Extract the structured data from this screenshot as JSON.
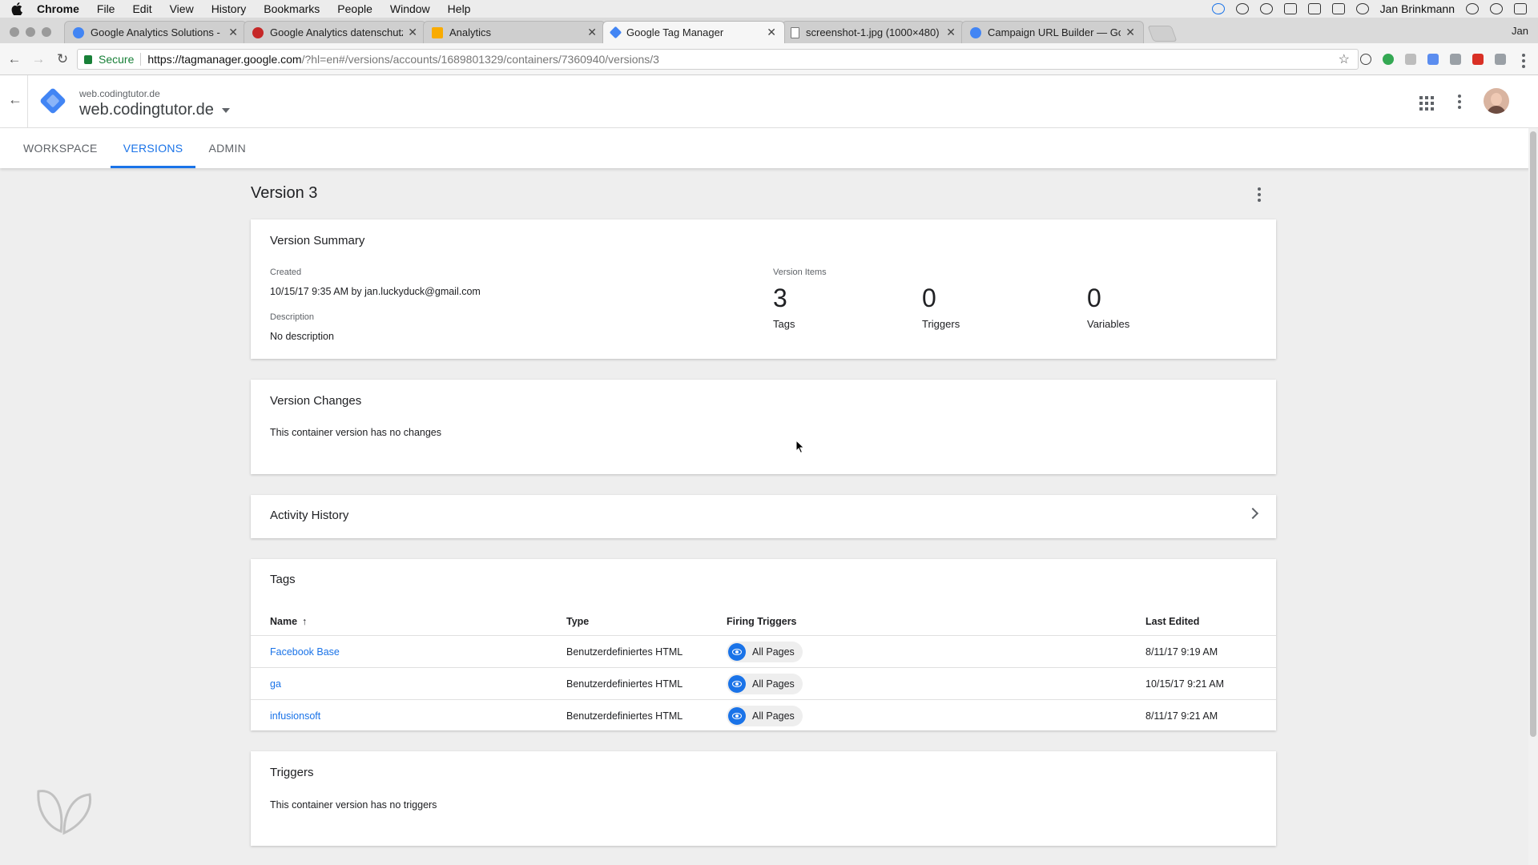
{
  "menubar": {
    "app": "Chrome",
    "items": [
      "File",
      "Edit",
      "View",
      "History",
      "Bookmarks",
      "People",
      "Window",
      "Help"
    ],
    "user": "Jan Brinkmann"
  },
  "browser": {
    "profile": "Jan",
    "tabs": [
      {
        "title": "Google Analytics Solutions - M",
        "favicon_color": "#4285f4",
        "active": false
      },
      {
        "title": "Google Analytics datenschutz",
        "favicon_color": "#c62828",
        "active": false
      },
      {
        "title": "Analytics",
        "favicon_color": "#f9ab00",
        "active": false
      },
      {
        "title": "Google Tag Manager",
        "favicon_color": "#4285f4",
        "active": true
      },
      {
        "title": "screenshot-1.jpg (1000×480)",
        "favicon_color": "#9e9e9e",
        "active": false
      },
      {
        "title": "Campaign URL Builder — Goo",
        "favicon_color": "#4285f4",
        "active": false
      }
    ],
    "secure_label": "Secure",
    "url_host": "https://tagmanager.google.com",
    "url_path": "/?hl=en#/versions/accounts/1689801329/containers/7360940/versions/3"
  },
  "header": {
    "account": "web.codingtutor.de",
    "container": "web.codingtutor.de"
  },
  "nav": {
    "tabs": [
      "WORKSPACE",
      "VERSIONS",
      "ADMIN"
    ],
    "active": "VERSIONS"
  },
  "page": {
    "title": "Version 3"
  },
  "summary": {
    "title": "Version Summary",
    "created_label": "Created",
    "created_value": "10/15/17 9:35 AM by jan.luckyduck@gmail.com",
    "description_label": "Description",
    "description_value": "No description",
    "items_label": "Version Items",
    "tags_count": "3",
    "tags_label": "Tags",
    "triggers_count": "0",
    "triggers_label": "Triggers",
    "variables_count": "0",
    "variables_label": "Variables"
  },
  "changes": {
    "title": "Version Changes",
    "message": "This container version has no changes"
  },
  "activity": {
    "title": "Activity History"
  },
  "tags": {
    "title": "Tags",
    "columns": {
      "name": "Name",
      "type": "Type",
      "triggers": "Firing Triggers",
      "edited": "Last Edited"
    },
    "sort_arrow": "↑",
    "rows": [
      {
        "name": "Facebook Base",
        "type": "Benutzerdefiniertes HTML",
        "trigger": "All Pages",
        "edited": "8/11/17 9:19 AM"
      },
      {
        "name": "ga",
        "type": "Benutzerdefiniertes HTML",
        "trigger": "All Pages",
        "edited": "10/15/17 9:21 AM"
      },
      {
        "name": "infusionsoft",
        "type": "Benutzerdefiniertes HTML",
        "trigger": "All Pages",
        "edited": "8/11/17 9:21 AM"
      }
    ]
  },
  "triggers": {
    "title": "Triggers",
    "message": "This container version has no triggers"
  },
  "colors": {
    "accent": "#1a73e8",
    "secure": "#188038"
  }
}
